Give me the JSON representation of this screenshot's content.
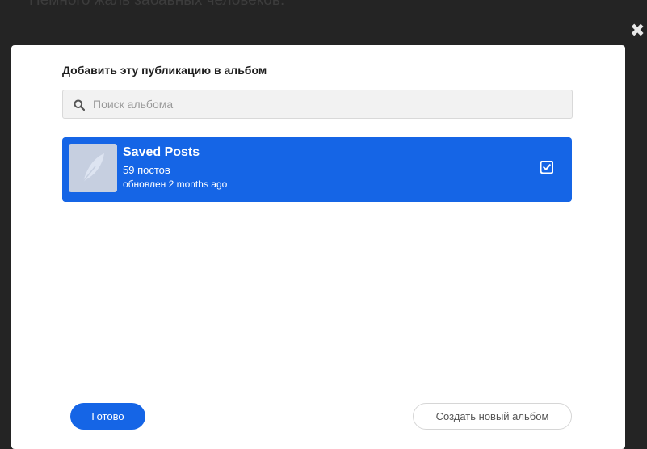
{
  "backdrop": {
    "text": "Немного жаль забавных человеков."
  },
  "modal": {
    "title": "Добавить эту публикацию в альбом",
    "search": {
      "placeholder": "Поиск альбома",
      "value": ""
    },
    "albums": [
      {
        "name": "Saved Posts",
        "count": "59 постов",
        "updated": "обновлен 2 months ago",
        "checked": true,
        "thumb_icon": "feather-icon"
      }
    ],
    "buttons": {
      "done_label": "Готово",
      "create_label": "Создать новый альбом"
    }
  },
  "colors": {
    "accent": "#1565e6",
    "backdrop": "#242424",
    "search_bg": "#f2f2f2",
    "thumb_bg": "#c6cfe0"
  },
  "icons": {
    "close": "close-icon",
    "search": "search-icon",
    "checkbox": "checkbox-checked-icon"
  }
}
